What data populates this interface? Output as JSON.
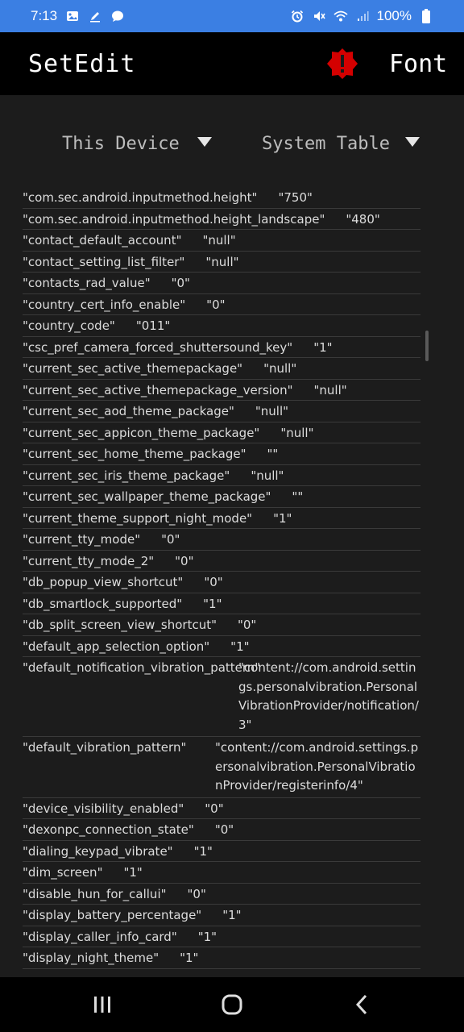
{
  "status": {
    "time": "7:13",
    "battery": "100%"
  },
  "appbar": {
    "title": "SetEdit",
    "font_label": "Font"
  },
  "selectors": {
    "device": "This Device",
    "table": "System Table"
  },
  "rows": [
    {
      "k": "\"com.sec.android.inputmethod.height\"",
      "v": "\"750\""
    },
    {
      "k": "\"com.sec.android.inputmethod.height_landscape\"",
      "v": "\"480\""
    },
    {
      "k": "\"contact_default_account\"",
      "v": "\"null\""
    },
    {
      "k": "\"contact_setting_list_filter\"",
      "v": "\"null\""
    },
    {
      "k": "\"contacts_rad_value\"",
      "v": "\"0\""
    },
    {
      "k": "\"country_cert_info_enable\"",
      "v": "\"0\""
    },
    {
      "k": "\"country_code\"",
      "v": "\"011\""
    },
    {
      "k": "\"csc_pref_camera_forced_shuttersound_key\"",
      "v": "\"1\""
    },
    {
      "k": "\"current_sec_active_themepackage\"",
      "v": "\"null\""
    },
    {
      "k": "\"current_sec_active_themepackage_version\"",
      "v": "\"null\""
    },
    {
      "k": "\"current_sec_aod_theme_package\"",
      "v": "\"null\""
    },
    {
      "k": "\"current_sec_appicon_theme_package\"",
      "v": "\"null\""
    },
    {
      "k": "\"current_sec_home_theme_package\"",
      "v": "\"\""
    },
    {
      "k": "\"current_sec_iris_theme_package\"",
      "v": "\"null\""
    },
    {
      "k": "\"current_sec_wallpaper_theme_package\"",
      "v": "\"\""
    },
    {
      "k": "\"current_theme_support_night_mode\"",
      "v": "\"1\""
    },
    {
      "k": "\"current_tty_mode\"",
      "v": "\"0\""
    },
    {
      "k": "\"current_tty_mode_2\"",
      "v": "\"0\""
    },
    {
      "k": "\"db_popup_view_shortcut\"",
      "v": "\"0\""
    },
    {
      "k": "\"db_smartlock_supported\"",
      "v": "\"1\""
    },
    {
      "k": "\"db_split_screen_view_shortcut\"",
      "v": "\"0\""
    },
    {
      "k": "\"default_app_selection_option\"",
      "v": "\"1\""
    },
    {
      "k": "\"default_notification_vibration_pattern\"",
      "v": "\"content://com.android.settings.personalvibration.PersonalVibrationProvider/notification/3\""
    },
    {
      "k": "\"default_vibration_pattern\"",
      "v": "\"content://com.android.settings.personalvibration.PersonalVibrationProvider/registerinfo/4\""
    },
    {
      "k": "\"device_visibility_enabled\"",
      "v": "\"0\""
    },
    {
      "k": "\"dexonpc_connection_state\"",
      "v": "\"0\""
    },
    {
      "k": "\"dialing_keypad_vibrate\"",
      "v": "\"1\""
    },
    {
      "k": "\"dim_screen\"",
      "v": "\"1\""
    },
    {
      "k": "\"disable_hun_for_callui\"",
      "v": "\"0\""
    },
    {
      "k": "\"display_battery_percentage\"",
      "v": "\"1\""
    },
    {
      "k": "\"display_caller_info_card\"",
      "v": "\"1\""
    },
    {
      "k": "\"display_night_theme\"",
      "v": "\"1\""
    }
  ],
  "icons": {
    "warning": "warning-icon",
    "dropdown": "chevron-down-icon"
  },
  "colors": {
    "status_bar": "#3b7fe3",
    "app_bar": "#000000",
    "background": "#1c1c1c",
    "warning": "#d40000"
  }
}
